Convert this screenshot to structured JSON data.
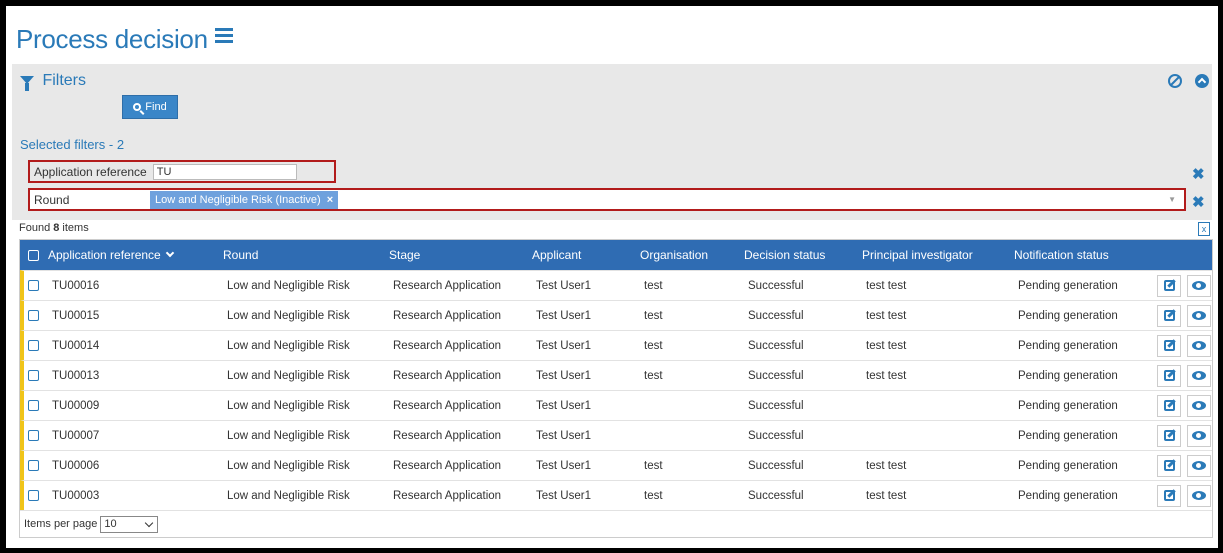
{
  "page": {
    "title": "Process decision"
  },
  "filters": {
    "heading": "Filters",
    "find_label": "Find",
    "selected_label": "Selected filters - 2",
    "application_reference": {
      "label": "Application reference",
      "value": "TU"
    },
    "round": {
      "label": "Round",
      "tag": "Low and Negligible Risk (Inactive)",
      "tag_remove": "×"
    },
    "clear_glyph": "✖"
  },
  "results": {
    "found_prefix": "Found ",
    "found_count": "8",
    "found_suffix": " items"
  },
  "grid": {
    "columns": [
      "Application reference",
      "Round",
      "Stage",
      "Applicant",
      "Organisation",
      "Decision status",
      "Principal investigator",
      "Notification status"
    ],
    "rows": [
      {
        "ref": "TU00016",
        "round": "Low and Negligible Risk",
        "stage": "Research Application",
        "applicant": "Test User1",
        "org": "test",
        "decision": "Successful",
        "pi": "test test",
        "notification": "Pending generation"
      },
      {
        "ref": "TU00015",
        "round": "Low and Negligible Risk",
        "stage": "Research Application",
        "applicant": "Test User1",
        "org": "test",
        "decision": "Successful",
        "pi": "test test",
        "notification": "Pending generation"
      },
      {
        "ref": "TU00014",
        "round": "Low and Negligible Risk",
        "stage": "Research Application",
        "applicant": "Test User1",
        "org": "test",
        "decision": "Successful",
        "pi": "test test",
        "notification": "Pending generation"
      },
      {
        "ref": "TU00013",
        "round": "Low and Negligible Risk",
        "stage": "Research Application",
        "applicant": "Test User1",
        "org": "test",
        "decision": "Successful",
        "pi": "test test",
        "notification": "Pending generation"
      },
      {
        "ref": "TU00009",
        "round": "Low and Negligible Risk",
        "stage": "Research Application",
        "applicant": "Test User1",
        "org": "",
        "decision": "Successful",
        "pi": "",
        "notification": "Pending generation"
      },
      {
        "ref": "TU00007",
        "round": "Low and Negligible Risk",
        "stage": "Research Application",
        "applicant": "Test User1",
        "org": "",
        "decision": "Successful",
        "pi": "",
        "notification": "Pending generation"
      },
      {
        "ref": "TU00006",
        "round": "Low and Negligible Risk",
        "stage": "Research Application",
        "applicant": "Test User1",
        "org": "test",
        "decision": "Successful",
        "pi": "test test",
        "notification": "Pending generation"
      },
      {
        "ref": "TU00003",
        "round": "Low and Negligible Risk",
        "stage": "Research Application",
        "applicant": "Test User1",
        "org": "test",
        "decision": "Successful",
        "pi": "test test",
        "notification": "Pending generation"
      }
    ],
    "items_per_page_label": "Items per page",
    "items_per_page_value": "10"
  },
  "colors": {
    "accent": "#2a7ab8",
    "header_bg": "#2f6cb3",
    "row_marker": "#f0c419",
    "highlight_border": "#b21b1b"
  }
}
